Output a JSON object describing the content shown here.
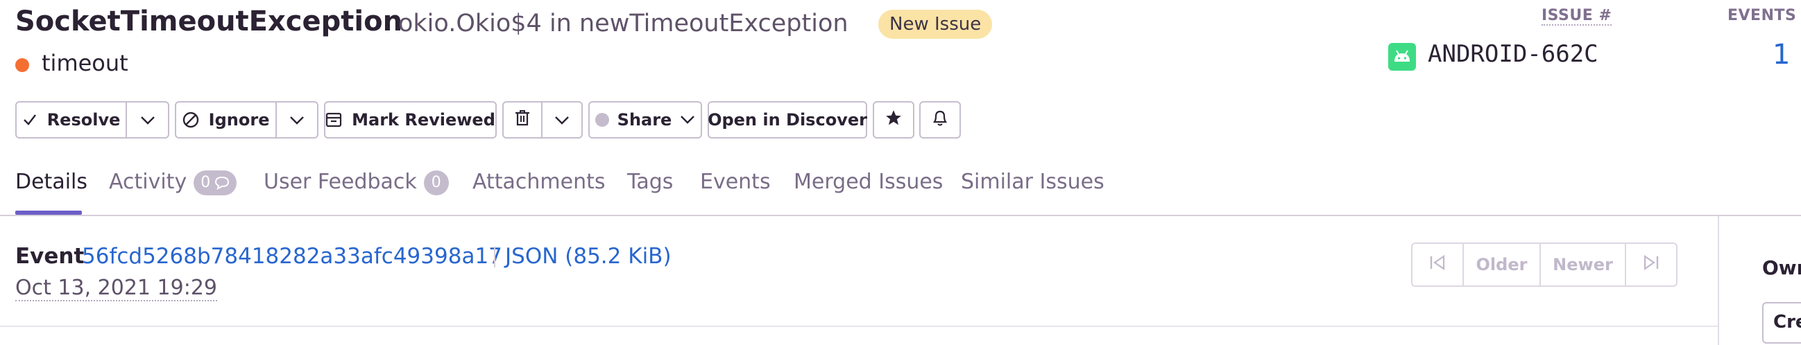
{
  "header": {
    "title": "SocketTimeoutException",
    "culprit": "okio.Okio$4 in newTimeoutException",
    "badge": "New Issue",
    "message": "timeout",
    "issue_label": "ISSUE #",
    "short_id": "ANDROID-662C",
    "events_label": "EVENTS",
    "events_count": "1"
  },
  "actions": {
    "resolve": "Resolve",
    "ignore": "Ignore",
    "mark_reviewed": "Mark Reviewed",
    "share": "Share",
    "open_discover": "Open in Discover"
  },
  "tabs": [
    {
      "label": "Details"
    },
    {
      "label": "Activity",
      "count": "0"
    },
    {
      "label": "User Feedback",
      "count": "0"
    },
    {
      "label": "Attachments"
    },
    {
      "label": "Tags"
    },
    {
      "label": "Events"
    },
    {
      "label": "Merged Issues"
    },
    {
      "label": "Similar Issues"
    }
  ],
  "event": {
    "label": "Event",
    "id": "56fcd5268b78418282a33afc49398a17",
    "json": "JSON (85.2 KiB)",
    "date": "Oct 13, 2021 19:29",
    "older": "Older",
    "newer": "Newer"
  },
  "sidebar": {
    "owner_label": "Own",
    "create_label": "Cre"
  },
  "colors": {
    "accent": "#6c5fc7",
    "link": "#2866cf",
    "badge_bg": "#fbe3a6",
    "level_dot": "#f56f33",
    "android": "#3ddc84"
  },
  "icons": [
    "checkmark-icon",
    "chevron-down-icon",
    "ignore-icon",
    "mark-reviewed-icon",
    "trash-icon",
    "star-icon",
    "bell-icon",
    "android-icon",
    "chat-bubble-icon",
    "first-page-icon",
    "last-page-icon"
  ]
}
